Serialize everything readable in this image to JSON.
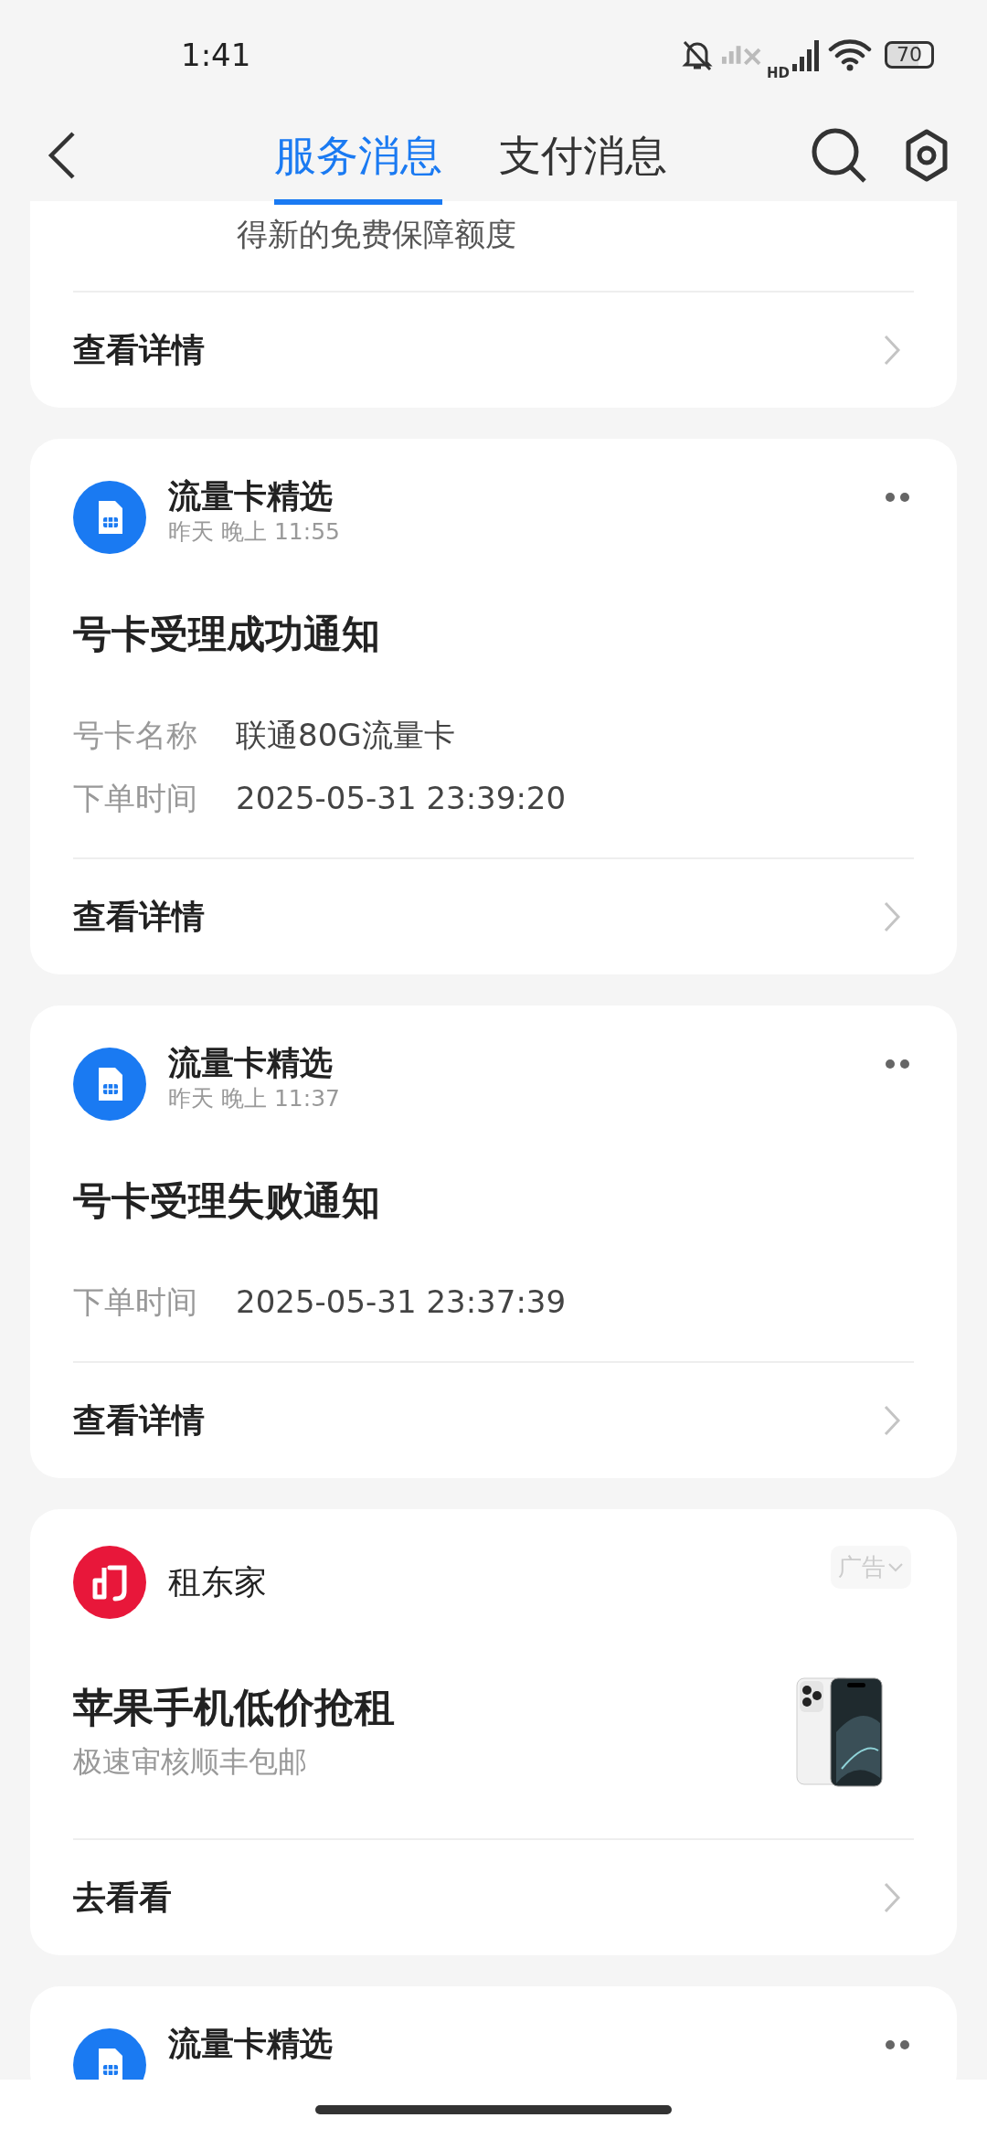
{
  "status_bar": {
    "time": "1:41",
    "network_label": "HD",
    "battery": "70"
  },
  "header": {
    "tabs": [
      {
        "label": "服务消息",
        "selected": true
      },
      {
        "label": "支付消息",
        "selected": false
      }
    ]
  },
  "cards": [
    {
      "kind": "partial",
      "body": "得新的免费保障额度",
      "action": "查看详情"
    },
    {
      "kind": "notice",
      "sender": "流量卡精选",
      "time": "昨天 晚上 11:55",
      "heading": "号卡受理成功通知",
      "fields": [
        {
          "label": "号卡名称",
          "value": "联通80G流量卡"
        },
        {
          "label": "下单时间",
          "value": "2025-05-31 23:39:20"
        }
      ],
      "action": "查看详情"
    },
    {
      "kind": "notice",
      "sender": "流量卡精选",
      "time": "昨天 晚上 11:37",
      "heading": "号卡受理失败通知",
      "fields": [
        {
          "label": "下单时间",
          "value": "2025-05-31 23:37:39"
        }
      ],
      "action": "查看详情"
    },
    {
      "kind": "ad",
      "sender": "租东家",
      "tag": "广告",
      "heading": "苹果手机低价抢租",
      "subtitle": "极速审核顺丰包邮",
      "action": "去看看"
    },
    {
      "kind": "notice",
      "sender": "流量卡精选"
    }
  ]
}
